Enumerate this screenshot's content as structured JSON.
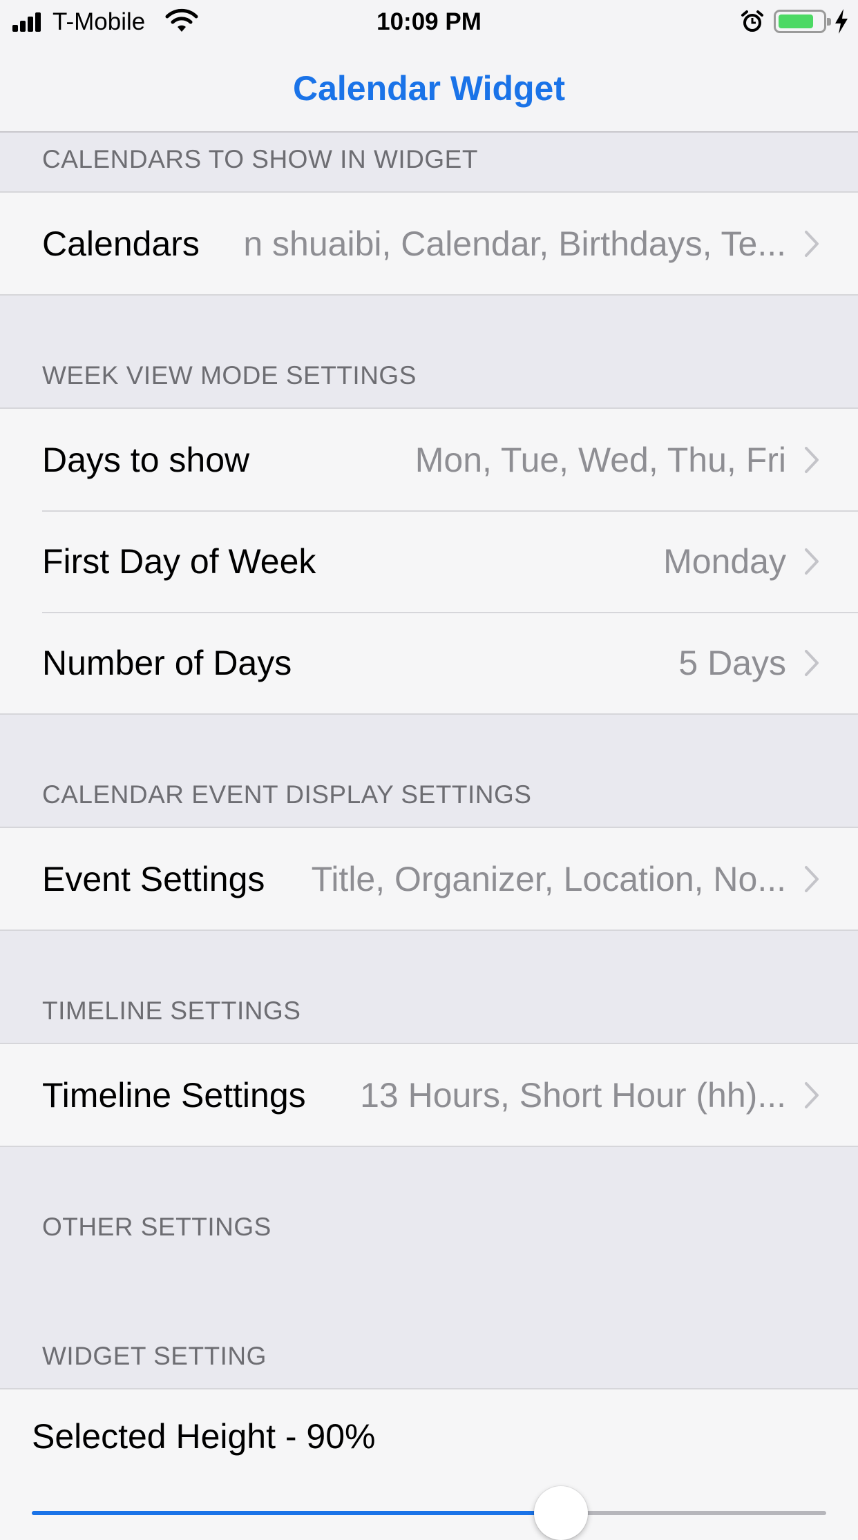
{
  "status_bar": {
    "carrier": "T-Mobile",
    "time": "10:09 PM",
    "battery_level": 0.8,
    "battery_color": "#4cd964"
  },
  "nav": {
    "title": "Calendar Widget",
    "accent_color": "#1a73e8"
  },
  "sections": {
    "calendars": {
      "header": "CALENDARS TO SHOW IN WIDGET",
      "rows": [
        {
          "label": "Calendars",
          "value": "n shuaibi, Calendar, Birthdays, Te..."
        }
      ]
    },
    "week_view": {
      "header": "WEEK VIEW MODE SETTINGS",
      "rows": [
        {
          "label": "Days to show",
          "value": "Mon, Tue, Wed, Thu, Fri"
        },
        {
          "label": "First Day of Week",
          "value": "Monday"
        },
        {
          "label": "Number of Days",
          "value": "5 Days"
        }
      ]
    },
    "event_display": {
      "header": "CALENDAR EVENT DISPLAY SETTINGS",
      "rows": [
        {
          "label": "Event Settings",
          "value": "Title, Organizer, Location, No..."
        }
      ]
    },
    "timeline": {
      "header": "TIMELINE SETTINGS",
      "rows": [
        {
          "label": "Timeline Settings",
          "value": "13 Hours, Short Hour (hh)..."
        }
      ]
    },
    "other": {
      "header": "OTHER SETTINGS"
    },
    "widget": {
      "header": "WIDGET SETTING",
      "slider_label": "Selected Height - 90%",
      "slider_value": 0.9
    }
  }
}
